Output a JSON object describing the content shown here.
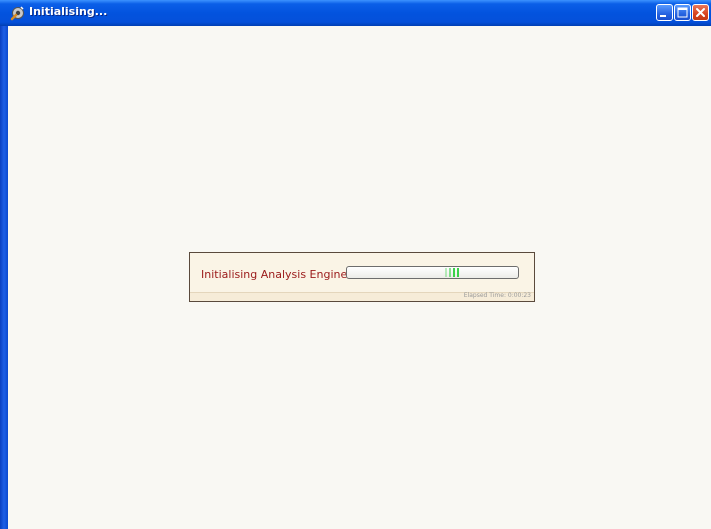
{
  "window": {
    "title": "Initialising...",
    "app_icon": "wrench-gear-icon",
    "buttons": {
      "minimize": "minimize-icon",
      "maximize": "maximize-icon",
      "close": "close-icon"
    }
  },
  "dialog": {
    "label": "Initialising Analysis Engine..",
    "elapsed_label": "Elapsed Time: 0:00:23",
    "progress_state": "indeterminate (marquee)"
  },
  "colors": {
    "titlebar": "#0353de",
    "label_text": "#9b1a1a",
    "progress_green": "#3bd14a",
    "dialog_bg": "#faf4e6"
  }
}
